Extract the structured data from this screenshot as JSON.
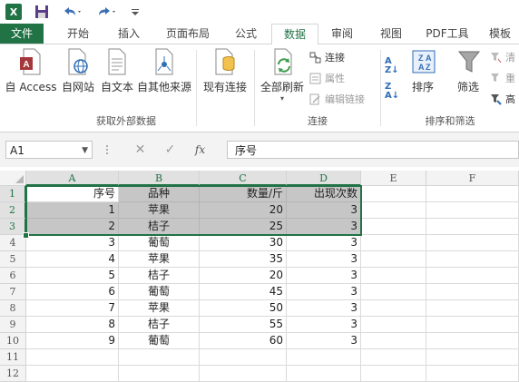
{
  "colors": {
    "excel_green": "#217346",
    "selection_gray": "#c6c6c6"
  },
  "qat": {
    "icons": [
      "excel-logo-icon",
      "save-icon",
      "undo-icon",
      "redo-icon",
      "customize-icon"
    ],
    "logo_text": "X"
  },
  "tabs": [
    "文件",
    "开始",
    "插入",
    "页面布局",
    "公式",
    "数据",
    "审阅",
    "视图",
    "PDF工具",
    "模板"
  ],
  "active_tab": "数据",
  "ribbon": {
    "get_external": {
      "buttons": [
        "自 Access",
        "自网站",
        "自文本",
        "自其他来源",
        "现有连接"
      ],
      "label": "获取外部数据"
    },
    "connections": {
      "refresh_all": "全部刷新",
      "small": [
        "连接",
        "属性",
        "编辑链接"
      ],
      "label": "连接"
    },
    "sort_filter": {
      "sort": "排序",
      "filter": "筛选",
      "small": [
        "清",
        "重",
        "高"
      ],
      "label": "排序和筛选"
    }
  },
  "formula_bar": {
    "name_box": "A1",
    "cancel_symbol": "✕",
    "enter_symbol": "✓",
    "fx": "fx",
    "content": "序号"
  },
  "sheet": {
    "columns": [
      "A",
      "B",
      "C",
      "D",
      "E",
      "F"
    ],
    "rows": [
      "1",
      "2",
      "3",
      "4",
      "5",
      "6",
      "7",
      "8",
      "9",
      "10",
      "11",
      "12"
    ],
    "data": [
      [
        "序号",
        "品种",
        "数量/斤",
        "出现次数"
      ],
      [
        "1",
        "苹果",
        "20",
        "3"
      ],
      [
        "2",
        "桔子",
        "25",
        "3"
      ],
      [
        "3",
        "葡萄",
        "30",
        "3"
      ],
      [
        "4",
        "苹果",
        "35",
        "3"
      ],
      [
        "5",
        "桔子",
        "20",
        "3"
      ],
      [
        "6",
        "葡萄",
        "45",
        "3"
      ],
      [
        "7",
        "苹果",
        "50",
        "3"
      ],
      [
        "8",
        "桔子",
        "55",
        "3"
      ],
      [
        "9",
        "葡萄",
        "60",
        "3"
      ]
    ]
  }
}
